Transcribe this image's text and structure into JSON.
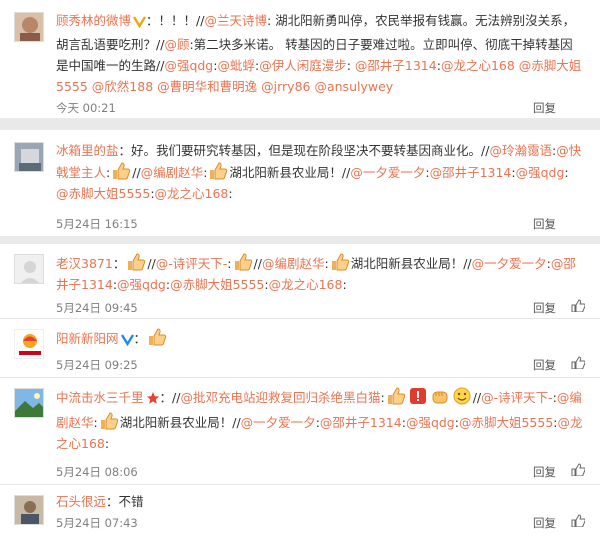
{
  "comments": [
    {
      "user": "顾秀林的微博",
      "colon": "：！！！//",
      "segments": [
        {
          "t": "@兰天诗博",
          "at": true
        },
        {
          "t": ": 湖北阳新勇叫停，农民举报有钱赢。无法辨别沒关系，胡言乱语要吃刑？//"
        },
        {
          "t": "@顾",
          "at": true
        },
        {
          "t": ":第二块多米诺。 转基因的日子要难过啦。立即叫停、彻底干掉转基因是中国唯一的生路//"
        },
        {
          "t": "@强qdg",
          "at": true
        },
        {
          "t": ":"
        },
        {
          "t": "@蚍蜉",
          "at": true
        },
        {
          "t": ":"
        },
        {
          "t": "@伊人闲庭漫步",
          "at": true
        },
        {
          "t": ": "
        },
        {
          "t": "@邵井子1314",
          "at": true
        },
        {
          "t": ":"
        },
        {
          "t": "@龙之心168",
          "at": true
        },
        {
          "t": " "
        },
        {
          "t": "@赤脚大姐5555",
          "at": true
        },
        {
          "t": " "
        },
        {
          "t": "@欣然188",
          "at": true
        },
        {
          "t": " "
        },
        {
          "t": "@曹明华和曹明逸",
          "at": true
        },
        {
          "t": " "
        },
        {
          "t": "@jrry86",
          "at": true
        },
        {
          "t": " "
        },
        {
          "t": "@ansulywey",
          "at": true
        }
      ],
      "time": "今天 00:21",
      "reply": "回复"
    },
    {
      "user": "冰箱里的盐",
      "colon": "：好。我们要研究转基因，但是现在阶段坚决不要转基因商业化。//",
      "segments": [
        {
          "t": "@玲瀚霭语",
          "at": true
        },
        {
          "t": ":"
        },
        {
          "t": "@快戟堂主人",
          "at": true
        },
        {
          "t": ":"
        },
        {
          "emo": "thumb"
        },
        {
          "t": "//"
        },
        {
          "t": "@编剧赵华",
          "at": true
        },
        {
          "t": ":"
        },
        {
          "emo": "thumb"
        },
        {
          "t": "湖北阳新县农业局！//"
        },
        {
          "t": "@一夕爱一夕",
          "at": true
        },
        {
          "t": ":"
        },
        {
          "t": "@邵井子1314",
          "at": true
        },
        {
          "t": ":"
        },
        {
          "t": "@强qdg",
          "at": true
        },
        {
          "t": ": "
        },
        {
          "t": "@赤脚大姐5555",
          "at": true
        },
        {
          "t": ":"
        },
        {
          "t": "@龙之心168",
          "at": true
        },
        {
          "t": ":"
        }
      ],
      "time": "5月24日 16:15",
      "reply": "回复"
    },
    {
      "user": "老汉3871",
      "colon": "：",
      "segments": [
        {
          "emo": "thumb"
        },
        {
          "t": "//"
        },
        {
          "t": "@-诗评天下-",
          "at": true
        },
        {
          "t": ":"
        },
        {
          "emo": "thumb"
        },
        {
          "t": "//"
        },
        {
          "t": "@编剧赵华",
          "at": true
        },
        {
          "t": ":"
        },
        {
          "emo": "thumb"
        },
        {
          "t": "湖北阳新县农业局！//"
        },
        {
          "t": "@一夕爱一夕",
          "at": true
        },
        {
          "t": ":"
        },
        {
          "t": "@邵井子1314",
          "at": true
        },
        {
          "t": ":"
        },
        {
          "t": "@强qdg",
          "at": true
        },
        {
          "t": ":"
        },
        {
          "t": "@赤脚大姐5555",
          "at": true
        },
        {
          "t": ":"
        },
        {
          "t": "@龙之心168",
          "at": true
        },
        {
          "t": ":"
        }
      ],
      "time": "5月24日 09:45",
      "reply": "回复",
      "like": true
    },
    {
      "user": "阳新新阳网",
      "colon": "：",
      "verified": true,
      "segments": [
        {
          "emo": "thumb"
        }
      ],
      "time": "5月24日 09:25",
      "reply": "回复",
      "like": true
    },
    {
      "user": "中流击水三千里",
      "colon": "：//",
      "star": true,
      "segments": [
        {
          "t": "@批邓充电站迎救复回归杀绝黑白猫",
          "at": true
        },
        {
          "t": ":"
        },
        {
          "emo": "thumb"
        },
        {
          "emo": "red"
        },
        {
          "emo": "fist"
        },
        {
          "emo": "face"
        },
        {
          "t": "//"
        },
        {
          "t": "@-诗评天下-",
          "at": true
        },
        {
          "t": ":"
        },
        {
          "t": "@编剧赵华",
          "at": true
        },
        {
          "t": ":"
        },
        {
          "emo": "thumb"
        },
        {
          "t": "湖北阳新县农业局！//"
        },
        {
          "t": "@一夕爱一夕",
          "at": true
        },
        {
          "t": ":"
        },
        {
          "t": "@邵井子1314",
          "at": true
        },
        {
          "t": ":"
        },
        {
          "t": "@强qdg",
          "at": true
        },
        {
          "t": ":"
        },
        {
          "t": "@赤脚大姐5555",
          "at": true
        },
        {
          "t": ":"
        },
        {
          "t": "@龙之心168",
          "at": true
        },
        {
          "t": ":"
        }
      ],
      "time": "5月24日 08:06",
      "reply": "回复",
      "like": true
    },
    {
      "user": "石头很远",
      "colon": "：不错",
      "segments": [],
      "time": "5月24日 07:43",
      "reply": "回复",
      "like": true
    }
  ],
  "colors": {
    "link": "#eb7350",
    "text": "#333333",
    "meta": "#808080",
    "vip": "#f2a50c",
    "verified": "#2b87e1"
  }
}
